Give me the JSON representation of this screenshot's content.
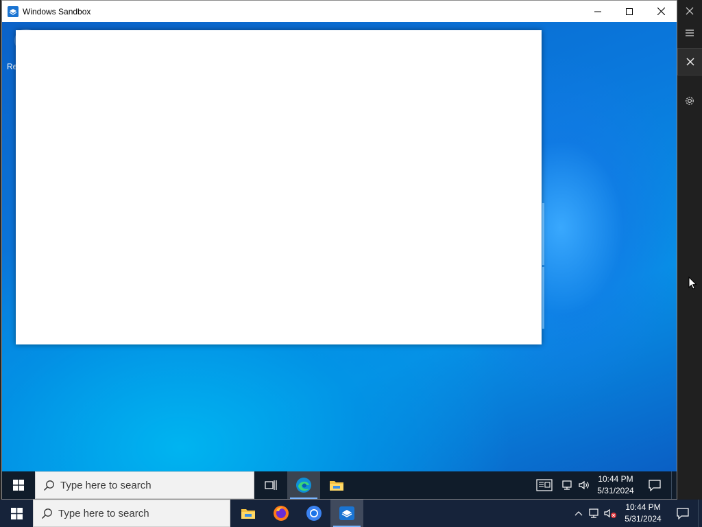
{
  "sandbox_window": {
    "title": "Windows Sandbox",
    "inner_desktop": {
      "recycle_bin_label_partial": "Re",
      "taskbar": {
        "search_placeholder": "Type here to search",
        "apps": [
          "task-view",
          "edge",
          "file-explorer"
        ],
        "clock": {
          "time": "10:44 PM",
          "date": "5/31/2024"
        }
      }
    }
  },
  "host_taskbar": {
    "search_placeholder": "Type here to search",
    "apps": [
      "file-explorer",
      "firefox",
      "chrome",
      "windows-sandbox"
    ],
    "clock": {
      "time": "10:44 PM",
      "date": "5/31/2024"
    }
  },
  "colors": {
    "desktop_blue": "#0a78dc",
    "inner_taskbar": "#101c2a",
    "host_taskbar": "#16233a",
    "host_panel": "#202020"
  }
}
